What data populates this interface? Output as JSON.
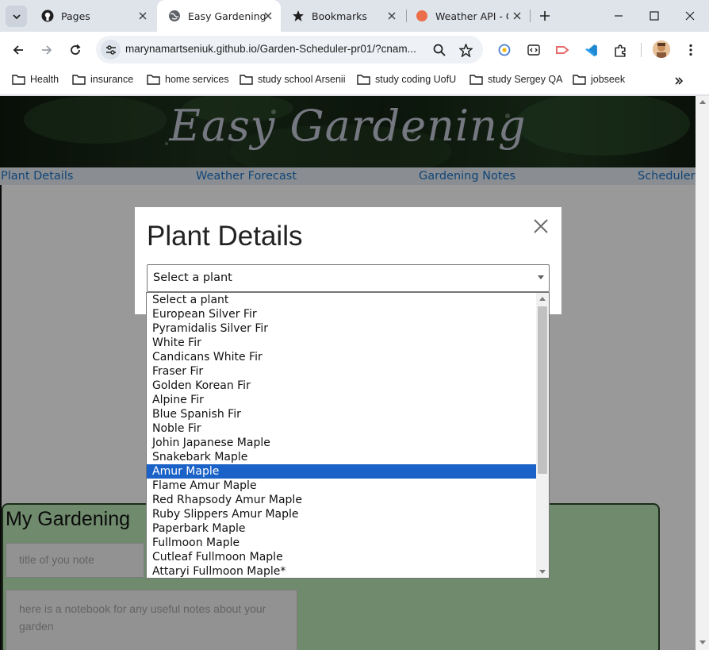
{
  "browser": {
    "tabs": [
      {
        "title": "Pages",
        "icon": "github-icon"
      },
      {
        "title": "Easy Gardening",
        "icon": "globe-icon",
        "active": true
      },
      {
        "title": "Bookmarks",
        "icon": "star-icon"
      },
      {
        "title": "Weather API - O",
        "icon": "openweather-icon"
      }
    ],
    "url": "marynamartseniuk.github.io/Garden-Scheduler-pr01/?cnam...",
    "bookmarks": [
      "Health",
      "insurance",
      "home services",
      "study school Arsenii",
      "study coding UofU",
      "study Sergey QA",
      "jobseek"
    ]
  },
  "site": {
    "title": "Easy Gardening",
    "nav": [
      "Plant Details",
      "Weather Forecast",
      "Gardening Notes",
      "Scheduler"
    ]
  },
  "notes": {
    "title": "My Gardening",
    "title_placeholder": "title of you note",
    "body_placeholder": "here is a notebook for any useful notes about your garden"
  },
  "modal": {
    "title": "Plant Details",
    "select_value": "Select a plant",
    "close_symbol": "×"
  },
  "dropdown": {
    "selected_index": 12,
    "options": [
      "Select a plant",
      "European Silver Fir",
      "Pyramidalis Silver Fir",
      "White Fir",
      "Candicans White Fir",
      "Fraser Fir",
      "Golden Korean Fir",
      "Alpine Fir",
      "Blue Spanish Fir",
      "Noble Fir",
      "Johin Japanese Maple",
      "Snakebark Maple",
      "Amur Maple",
      "Flame Amur Maple",
      "Red Rhapsody Amur Maple",
      "Ruby Slippers Amur Maple",
      "Paperbark Maple",
      "Fullmoon Maple",
      "Cutleaf Fullmoon Maple",
      "Attaryi Fullmoon Maple*"
    ]
  },
  "colors": {
    "accent_link": "#1a73c8",
    "selected_option": "#1a62c7",
    "notes_panel": "#b9e6b4"
  }
}
